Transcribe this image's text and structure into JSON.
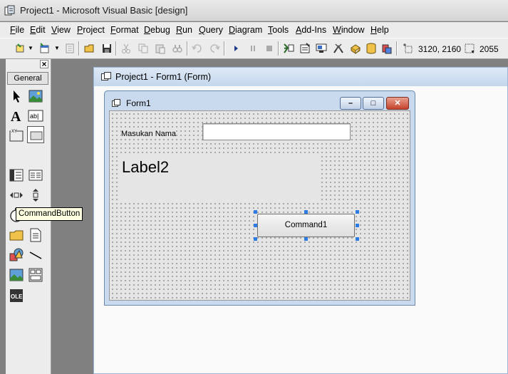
{
  "window": {
    "title": "Project1 - Microsoft Visual Basic [design]"
  },
  "menu": [
    "File",
    "Edit",
    "View",
    "Project",
    "Format",
    "Debug",
    "Run",
    "Query",
    "Diagram",
    "Tools",
    "Add-Ins",
    "Window",
    "Help"
  ],
  "toolbar": {
    "icons": [
      "add-project-icon",
      "add-form-icon",
      "menu-editor-icon",
      "open-project-icon",
      "save-project-icon",
      "cut-icon",
      "copy-icon",
      "paste-icon",
      "find-icon",
      "undo-icon",
      "redo-icon",
      "start-icon",
      "break-icon",
      "end-icon",
      "project-explorer-icon",
      "properties-window-icon",
      "form-layout-icon",
      "object-browser-icon",
      "toolbox-icon",
      "data-view-icon",
      "component-manager-icon"
    ],
    "position": "3120, 2160",
    "size": "2055"
  },
  "toolbox": {
    "tab_label": "General",
    "tooltip": "CommandButton",
    "tools": [
      "pointer",
      "picturebox",
      "label",
      "textbox",
      "frame",
      "commandbutton",
      "checkbox",
      "optionbutton",
      "combobox",
      "listbox",
      "hscrollbar",
      "vscrollbar",
      "timer",
      "drivelistbox",
      "dirlistbox",
      "filelistbox",
      "shape",
      "line",
      "image",
      "data",
      "ole"
    ]
  },
  "designer": {
    "title": "Project1 - Form1 (Form)"
  },
  "form": {
    "caption": "Form1",
    "label1": "Masukan Nama",
    "textbox_value": "",
    "label2": "Label2",
    "command1": "Command1"
  },
  "colors": {
    "selection_handle": "#2e7be3",
    "tooltip_bg": "#ffffe1",
    "form_border": "#c9daee",
    "close_button": "#c4432b"
  }
}
